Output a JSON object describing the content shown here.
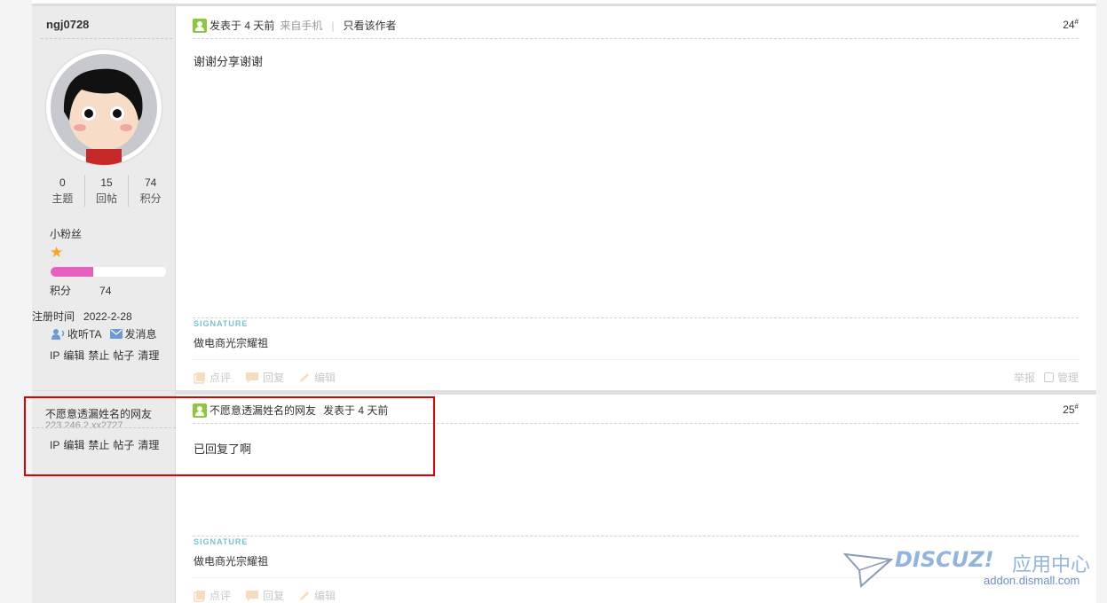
{
  "post1": {
    "username": "ngj0728",
    "stats": [
      {
        "value": "0",
        "label": "主题"
      },
      {
        "value": "15",
        "label": "回帖"
      },
      {
        "value": "74",
        "label": "积分"
      }
    ],
    "rank": "小粉丝",
    "progress_fraction": 0.37,
    "points_label": "积分",
    "points_value": "74",
    "reg_label": "注册时间",
    "reg_date": "2022-2-28",
    "follow_label": "收听TA",
    "message_label": "发消息",
    "admin_links": [
      "IP",
      "编辑",
      "禁止",
      "帖子",
      "清理"
    ],
    "posted": "发表于 4 天前",
    "source": "来自手机",
    "only_author": "只看该作者",
    "floor": "24",
    "content": "谢谢分享谢谢",
    "signature_label": "SIGNATURE",
    "signature": "做电商光宗耀祖",
    "actions": [
      "点评",
      "回复",
      "编辑"
    ],
    "report": "举报",
    "manage": "管理"
  },
  "post2": {
    "username": "不愿意透漏姓名的网友",
    "ip": "223.246.2.xx2727",
    "admin_links": [
      "IP",
      "编辑",
      "禁止",
      "帖子",
      "清理"
    ],
    "author": "不愿意透漏姓名的网友",
    "posted": "发表于 4 天前",
    "floor": "25",
    "content": "已回复了啊",
    "signature_label": "SIGNATURE",
    "signature": "做电商光宗耀祖",
    "actions": [
      "点评",
      "回复",
      "编辑"
    ]
  },
  "watermark": {
    "brand": "DISCUZ!",
    "center": "应用中心",
    "url": "addon.dismall.com"
  },
  "colors": {
    "highlight_box": "#e00000",
    "progress": "#e85fbf",
    "star": "#f5a623",
    "user_icon": "#8dc63f",
    "signature": "#7ac1d6"
  }
}
